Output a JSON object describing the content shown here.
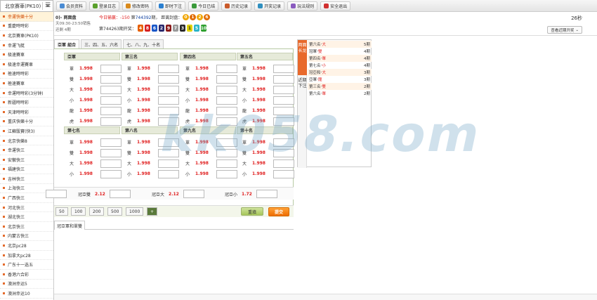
{
  "topbar": {
    "game_select": "北京賽車(PK10)",
    "nav": [
      {
        "label": "会员资料",
        "icon": "member-icon",
        "color": "#4a8bd3"
      },
      {
        "label": "登录日志",
        "icon": "log-icon",
        "color": "#5aa02c"
      },
      {
        "label": "修改密码",
        "icon": "key-icon",
        "color": "#d98a1c"
      },
      {
        "label": "即时下注",
        "icon": "bet-icon",
        "color": "#2a7fd0"
      },
      {
        "label": "今日已结",
        "icon": "calendar-icon",
        "color": "#3b9a3b"
      },
      {
        "label": "历史记录",
        "icon": "history-icon",
        "color": "#c95a2a"
      },
      {
        "label": "开奖记录",
        "icon": "result-icon",
        "color": "#2f8fbf"
      },
      {
        "label": "玩法规则",
        "icon": "rules-icon",
        "color": "#8a5bbf"
      },
      {
        "label": "安全退出",
        "icon": "logout-icon",
        "color": "#d03030"
      }
    ]
  },
  "sidebar": {
    "items": [
      "幸運快樂十分",
      "重慶時時彩",
      "北京賽車(PK10)",
      "幸運飞艇",
      "极速賽車",
      "极速幸運賽車",
      "極速時時彩",
      "極速賽車",
      "幸運時時彩(3分钟)",
      "新疆時時彩",
      "天津時時彩",
      "重庆快樂十分",
      "江蘇骰寶(快3)",
      "北京快樂8",
      "幸運快三",
      "安徽快三",
      "福建快三",
      "吉林快三",
      "上海快三",
      "广西快三",
      "河北快三",
      "湖北快三",
      "北京快三",
      "内蒙古快三",
      "北京pc28",
      "加拿大pc28",
      "广东十一选五",
      "香港六合彩",
      "澳洲幸运5",
      "澳洲幸运10"
    ],
    "active_index": 0
  },
  "info": {
    "line1": "0)- 两面盘",
    "line2": "天09:30-23:50销售",
    "line3": "还剩 4期",
    "today_label": "今日输赢：",
    "today_value": "-150",
    "period_prefix": "第",
    "period": "744392",
    "period_suffix": "期， 距离封盘：",
    "countdown_digits": [
      {
        "d": "0",
        "c": "#f0a500"
      },
      {
        "d": "1",
        "c": "#e06b00"
      },
      {
        "d": "2",
        "c": "#f0a500"
      },
      {
        "d": "6",
        "c": "#e06b00"
      }
    ],
    "prev_period_label": "第744263期开奖：",
    "prev_balls": [
      {
        "n": "4",
        "c": "#e65f00"
      },
      {
        "n": "8",
        "c": "#d62020"
      },
      {
        "n": "6",
        "c": "#1a57c7"
      },
      {
        "n": "2",
        "c": "#2a2a6e"
      },
      {
        "n": "9",
        "c": "#8a1b1b"
      },
      {
        "n": "7",
        "c": "#9a9a9a"
      },
      {
        "n": "3",
        "c": "#2a2a2a"
      },
      {
        "n": "1",
        "c": "#e0d100"
      },
      {
        "n": "5",
        "c": "#2bb5c8"
      },
      {
        "n": "10",
        "c": "#2fa02f"
      }
    ],
    "timer": "26秒",
    "recent_btn": "查看近期开奖"
  },
  "tabs": [
    "亞軍 組合",
    "三、四、五、六名",
    "七、八、九、十名"
  ],
  "columns_top": [
    {
      "title": "亞軍",
      "rows": [
        [
          "單",
          "1.998"
        ],
        [
          "雙",
          "1.998"
        ],
        [
          "大",
          "1.998"
        ],
        [
          "小",
          "1.998"
        ],
        [
          "龍",
          "1.998"
        ],
        [
          "虎",
          "1.998"
        ]
      ]
    },
    {
      "title": "第三名",
      "rows": [
        [
          "單",
          "1.998"
        ],
        [
          "雙",
          "1.998"
        ],
        [
          "大",
          "1.998"
        ],
        [
          "小",
          "1.998"
        ],
        [
          "龍",
          "1.998"
        ],
        [
          "虎",
          "1.998"
        ]
      ]
    },
    {
      "title": "第四名",
      "rows": [
        [
          "單",
          "1.998"
        ],
        [
          "雙",
          "1.998"
        ],
        [
          "大",
          "1.998"
        ],
        [
          "小",
          "1.998"
        ],
        [
          "龍",
          "1.998"
        ],
        [
          "虎",
          "1.998"
        ]
      ]
    },
    {
      "title": "第五名",
      "rows": [
        [
          "單",
          "1.998"
        ],
        [
          "雙",
          "1.998"
        ],
        [
          "大",
          "1.998"
        ],
        [
          "小",
          "1.998"
        ],
        [
          "龍",
          "1.998"
        ],
        [
          "虎",
          "1.998"
        ]
      ]
    }
  ],
  "columns_bottom": [
    {
      "title": "第七名",
      "rows": [
        [
          "單",
          "1.998"
        ],
        [
          "雙",
          "1.998"
        ],
        [
          "大",
          "1.998"
        ],
        [
          "小",
          "1.998"
        ]
      ]
    },
    {
      "title": "第八名",
      "rows": [
        [
          "單",
          "1.998"
        ],
        [
          "雙",
          "1.998"
        ],
        [
          "大",
          "1.998"
        ],
        [
          "小",
          "1.998"
        ]
      ]
    },
    {
      "title": "第九名",
      "rows": [
        [
          "單",
          "1.998"
        ],
        [
          "雙",
          "1.998"
        ],
        [
          "大",
          "1.998"
        ],
        [
          "小",
          "1.998"
        ]
      ]
    },
    {
      "title": "第十名",
      "rows": [
        [
          "單",
          "1.998"
        ],
        [
          "雙",
          "1.998"
        ],
        [
          "大",
          "1.998"
        ],
        [
          "小",
          "1.998"
        ]
      ]
    }
  ],
  "pair": [
    {
      "label": "冠亞雙",
      "odds": "2.12"
    },
    {
      "label": "冠亞大",
      "odds": "2.12"
    },
    {
      "label": "冠亞小",
      "odds": "1.72"
    }
  ],
  "chips": [
    "50",
    "100",
    "200",
    "500",
    "1000",
    "+"
  ],
  "buttons": {
    "reset": "重填",
    "submit": "提交"
  },
  "group_tab": "冠亞軍和單雙",
  "stats": {
    "side_a": "两面长龙",
    "side_b": "近期下注",
    "rows": [
      {
        "k": "第六名",
        "v": "大",
        "c": "5期"
      },
      {
        "k": "冠軍",
        "v": "雙",
        "c": "4期"
      },
      {
        "k": "第四名",
        "v": "單",
        "c": "4期"
      },
      {
        "k": "第七名",
        "v": "小",
        "c": "4期"
      },
      {
        "k": "冠亞和",
        "v": "大",
        "c": "3期"
      },
      {
        "k": "亞軍",
        "v": "龍",
        "c": "3期"
      },
      {
        "k": "第三名",
        "v": "雙",
        "c": "2期"
      },
      {
        "k": "第六名",
        "v": "單",
        "c": "2期"
      }
    ]
  },
  "watermark": "kk058.com"
}
